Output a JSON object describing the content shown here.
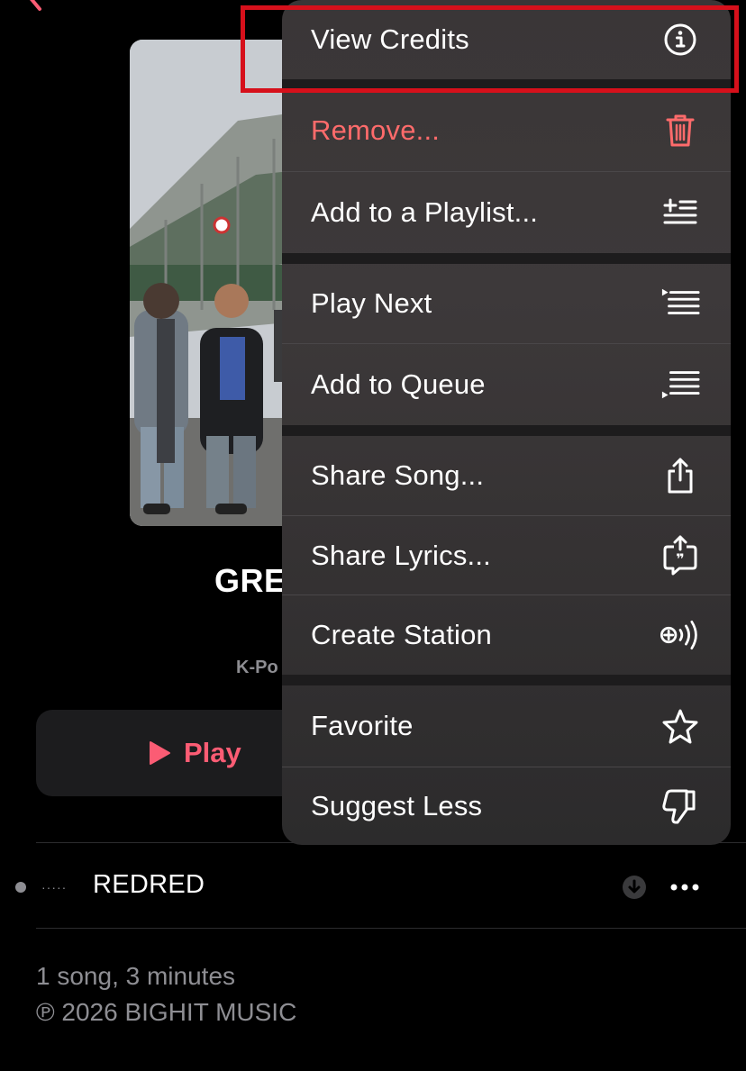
{
  "album": {
    "title_visible": "GRE",
    "genre_visible": "K-Po",
    "play_label": "Play"
  },
  "menu": {
    "items": [
      {
        "label": "View Credits",
        "icon": "info-circle-icon"
      },
      {
        "label": "Remove...",
        "icon": "trash-icon",
        "destructive": true
      },
      {
        "label": "Add to a Playlist...",
        "icon": "add-to-playlist-icon"
      },
      {
        "label": "Play Next",
        "icon": "play-next-icon"
      },
      {
        "label": "Add to Queue",
        "icon": "add-to-queue-icon"
      },
      {
        "label": "Share Song...",
        "icon": "share-icon"
      },
      {
        "label": "Share Lyrics...",
        "icon": "share-lyrics-icon"
      },
      {
        "label": "Create Station",
        "icon": "create-station-icon"
      },
      {
        "label": "Favorite",
        "icon": "star-icon"
      },
      {
        "label": "Suggest Less",
        "icon": "thumbs-down-icon"
      }
    ]
  },
  "track": {
    "title": "REDRED"
  },
  "footer": {
    "summary": "1 song, 3 minutes",
    "copyright": "℗ 2026 BIGHIT MUSIC"
  },
  "colors": {
    "accent": "#fb5c74",
    "destructive": "#ff6b6b",
    "highlight": "#d6101b"
  }
}
